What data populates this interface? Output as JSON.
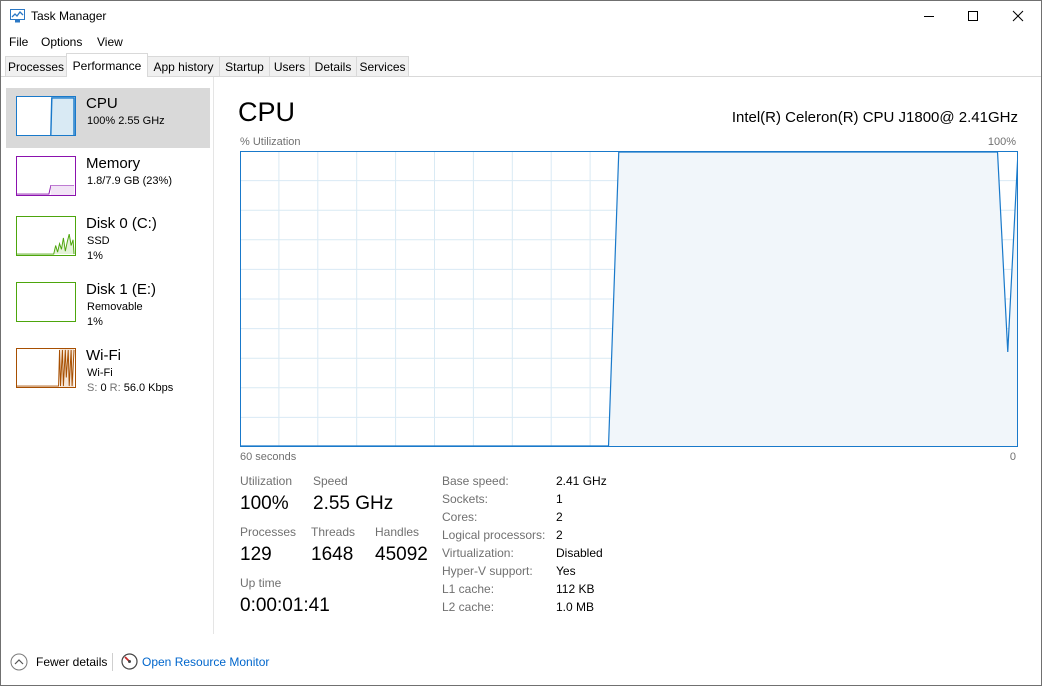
{
  "window": {
    "title": "Task Manager"
  },
  "menu": [
    "File",
    "Options",
    "View"
  ],
  "tabs": [
    {
      "label": "Processes",
      "active": false
    },
    {
      "label": "Performance",
      "active": true
    },
    {
      "label": "App history",
      "active": false
    },
    {
      "label": "Startup",
      "active": false
    },
    {
      "label": "Users",
      "active": false
    },
    {
      "label": "Details",
      "active": false
    },
    {
      "label": "Services",
      "active": false
    }
  ],
  "sidebar": {
    "items": [
      {
        "title": "CPU",
        "line1": "100%  2.55 GHz",
        "line2": "",
        "color": "#1979ca"
      },
      {
        "title": "Memory",
        "line1": "1.8/7.9 GB (23%)",
        "line2": "",
        "color": "#8b12ae"
      },
      {
        "title": "Disk 0 (C:)",
        "line1": "SSD",
        "line2": "1%",
        "color": "#4da60c"
      },
      {
        "title": "Disk 1 (E:)",
        "line1": "Removable",
        "line2": "1%",
        "color": "#4da60c"
      },
      {
        "title": "Wi-Fi",
        "line1": "Wi-Fi",
        "line2_label_s": "S:",
        "line2_val_s": "0",
        "line2_label_r": "R:",
        "line2_val_r": "56.0 Kbps",
        "color": "#a74f01"
      }
    ]
  },
  "main": {
    "title": "CPU",
    "model": "Intel(R) Celeron(R) CPU J1800@ 2.41GHz",
    "graph": {
      "y_label": "% Utilization",
      "y_max_label": "100%",
      "x_left_label": "60 seconds",
      "x_right_label": "0",
      "utilization_series": [
        0,
        0,
        0,
        0,
        0,
        0,
        0,
        0,
        0,
        0,
        0,
        0,
        0,
        0,
        0,
        0,
        0,
        0,
        0,
        0,
        0,
        0,
        0,
        0,
        0,
        0,
        0,
        0,
        0,
        0,
        0,
        0,
        0,
        0,
        0,
        0,
        0,
        100,
        100,
        100,
        100,
        100,
        100,
        100,
        100,
        100,
        100,
        100,
        100,
        100,
        100,
        100,
        100,
        100,
        100,
        100,
        100,
        100,
        100,
        100,
        100,
        100,
        100,
        100,
        100,
        100,
        100,
        100,
        100,
        100,
        100,
        100,
        100,
        100,
        100,
        32,
        100
      ],
      "line_color": "#1979ca",
      "fill_color": "#f1f6fa",
      "grid_color": "#d9eaf4"
    },
    "stats": {
      "utilization_label": "Utilization",
      "utilization": "100%",
      "speed_label": "Speed",
      "speed": "2.55 GHz",
      "processes_label": "Processes",
      "processes": "129",
      "threads_label": "Threads",
      "threads": "1648",
      "handles_label": "Handles",
      "handles": "45092",
      "uptime_label": "Up time",
      "uptime": "0:00:01:41"
    },
    "details": [
      {
        "label": "Base speed:",
        "value": "2.41 GHz"
      },
      {
        "label": "Sockets:",
        "value": "1"
      },
      {
        "label": "Cores:",
        "value": "2"
      },
      {
        "label": "Logical processors:",
        "value": "2"
      },
      {
        "label": "Virtualization:",
        "value": "Disabled"
      },
      {
        "label": "Hyper-V support:",
        "value": "Yes"
      },
      {
        "label": "L1 cache:",
        "value": "112 KB"
      },
      {
        "label": "L2 cache:",
        "value": "1.0 MB"
      }
    ]
  },
  "footer": {
    "fewer_details": "Fewer details",
    "open_resource_monitor": "Open Resource Monitor"
  }
}
